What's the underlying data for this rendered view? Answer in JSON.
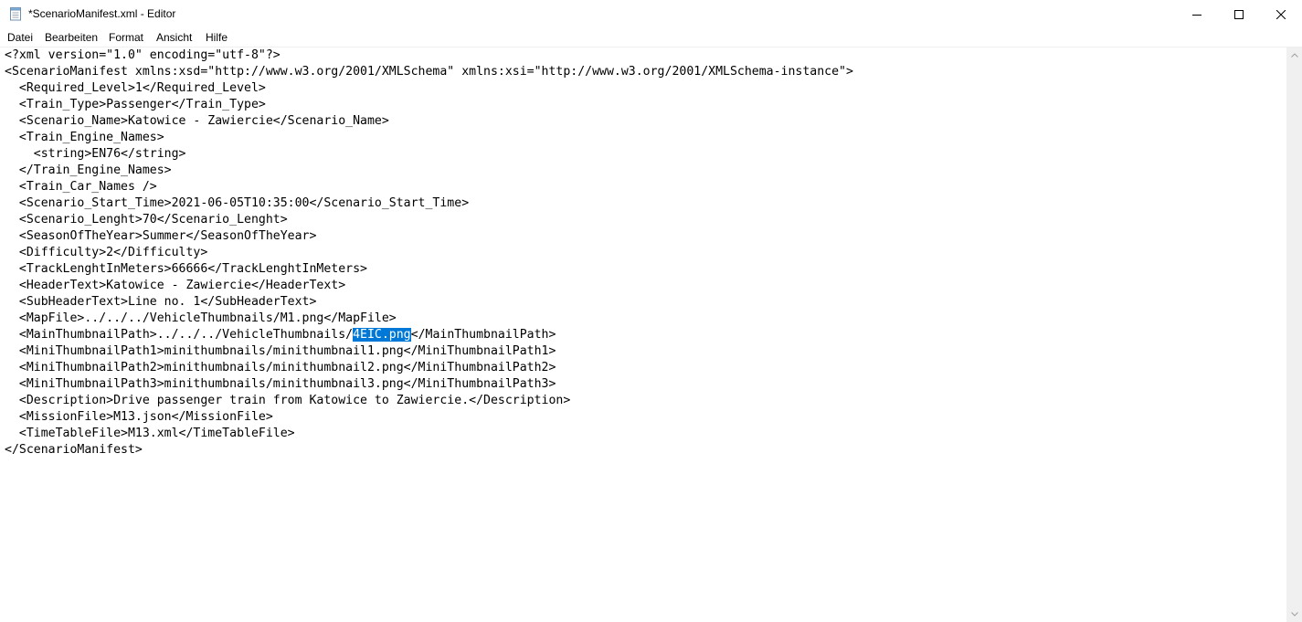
{
  "window": {
    "title": "*ScenarioManifest.xml - Editor"
  },
  "menu": {
    "items": [
      "Datei",
      "Bearbeiten",
      "Format",
      "Ansicht",
      "Hilfe"
    ]
  },
  "editor": {
    "lines": [
      "<?xml version=\"1.0\" encoding=\"utf-8\"?>",
      "<ScenarioManifest xmlns:xsd=\"http://www.w3.org/2001/XMLSchema\" xmlns:xsi=\"http://www.w3.org/2001/XMLSchema-instance\">",
      "  <Required_Level>1</Required_Level>",
      "  <Train_Type>Passenger</Train_Type>",
      "  <Scenario_Name>Katowice - Zawiercie</Scenario_Name>",
      "  <Train_Engine_Names>",
      "    <string>EN76</string>",
      "  </Train_Engine_Names>",
      "  <Train_Car_Names />",
      "  <Scenario_Start_Time>2021-06-05T10:35:00</Scenario_Start_Time>",
      "  <Scenario_Lenght>70</Scenario_Lenght>",
      "  <SeasonOfTheYear>Summer</SeasonOfTheYear>",
      "  <Difficulty>2</Difficulty>",
      "  <TrackLenghtInMeters>66666</TrackLenghtInMeters>",
      "  <HeaderText>Katowice - Zawiercie</HeaderText>",
      "  <SubHeaderText>Line no. 1</SubHeaderText>",
      "  <MapFile>../../../VehicleThumbnails/M1.png</MapFile>",
      "SELECTED_LINE",
      "  <MiniThumbnailPath1>minithumbnails/minithumbnail1.png</MiniThumbnailPath1>",
      "  <MiniThumbnailPath2>minithumbnails/minithumbnail2.png</MiniThumbnailPath2>",
      "  <MiniThumbnailPath3>minithumbnails/minithumbnail3.png</MiniThumbnailPath3>",
      "  <Description>Drive passenger train from Katowice to Zawiercie.</Description>",
      "  <MissionFile>M13.json</MissionFile>",
      "  <TimeTableFile>M13.xml</TimeTableFile>",
      "</ScenarioManifest>"
    ],
    "selected_line": {
      "before": "  <MainThumbnailPath>../../../VehicleThumbnails/",
      "selection": "4EIC.png",
      "after": "</MainThumbnailPath>"
    }
  },
  "colors": {
    "selection": "#0078d7",
    "scrollbar": "#f0f0f0"
  }
}
